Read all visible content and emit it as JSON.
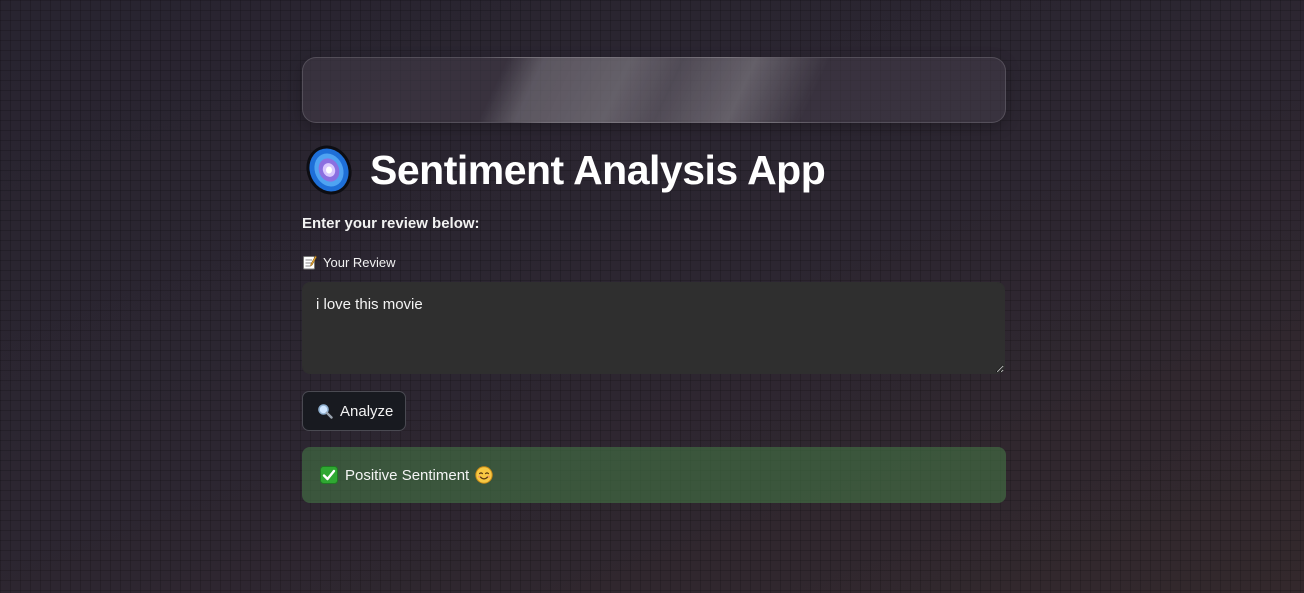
{
  "app": {
    "title": "Sentiment Analysis App",
    "title_icon": "galaxy-icon"
  },
  "form": {
    "instruction": "Enter your review below:",
    "review_label": "Your Review",
    "review_label_icon": "memo-icon",
    "review_value": "i love this movie",
    "analyze_button_label": "Analyze",
    "analyze_button_icon": "search-icon"
  },
  "result": {
    "text": "Positive Sentiment",
    "status_icon": "check-icon",
    "emoji_icon": "smile-icon",
    "accent_color": "#447646"
  }
}
